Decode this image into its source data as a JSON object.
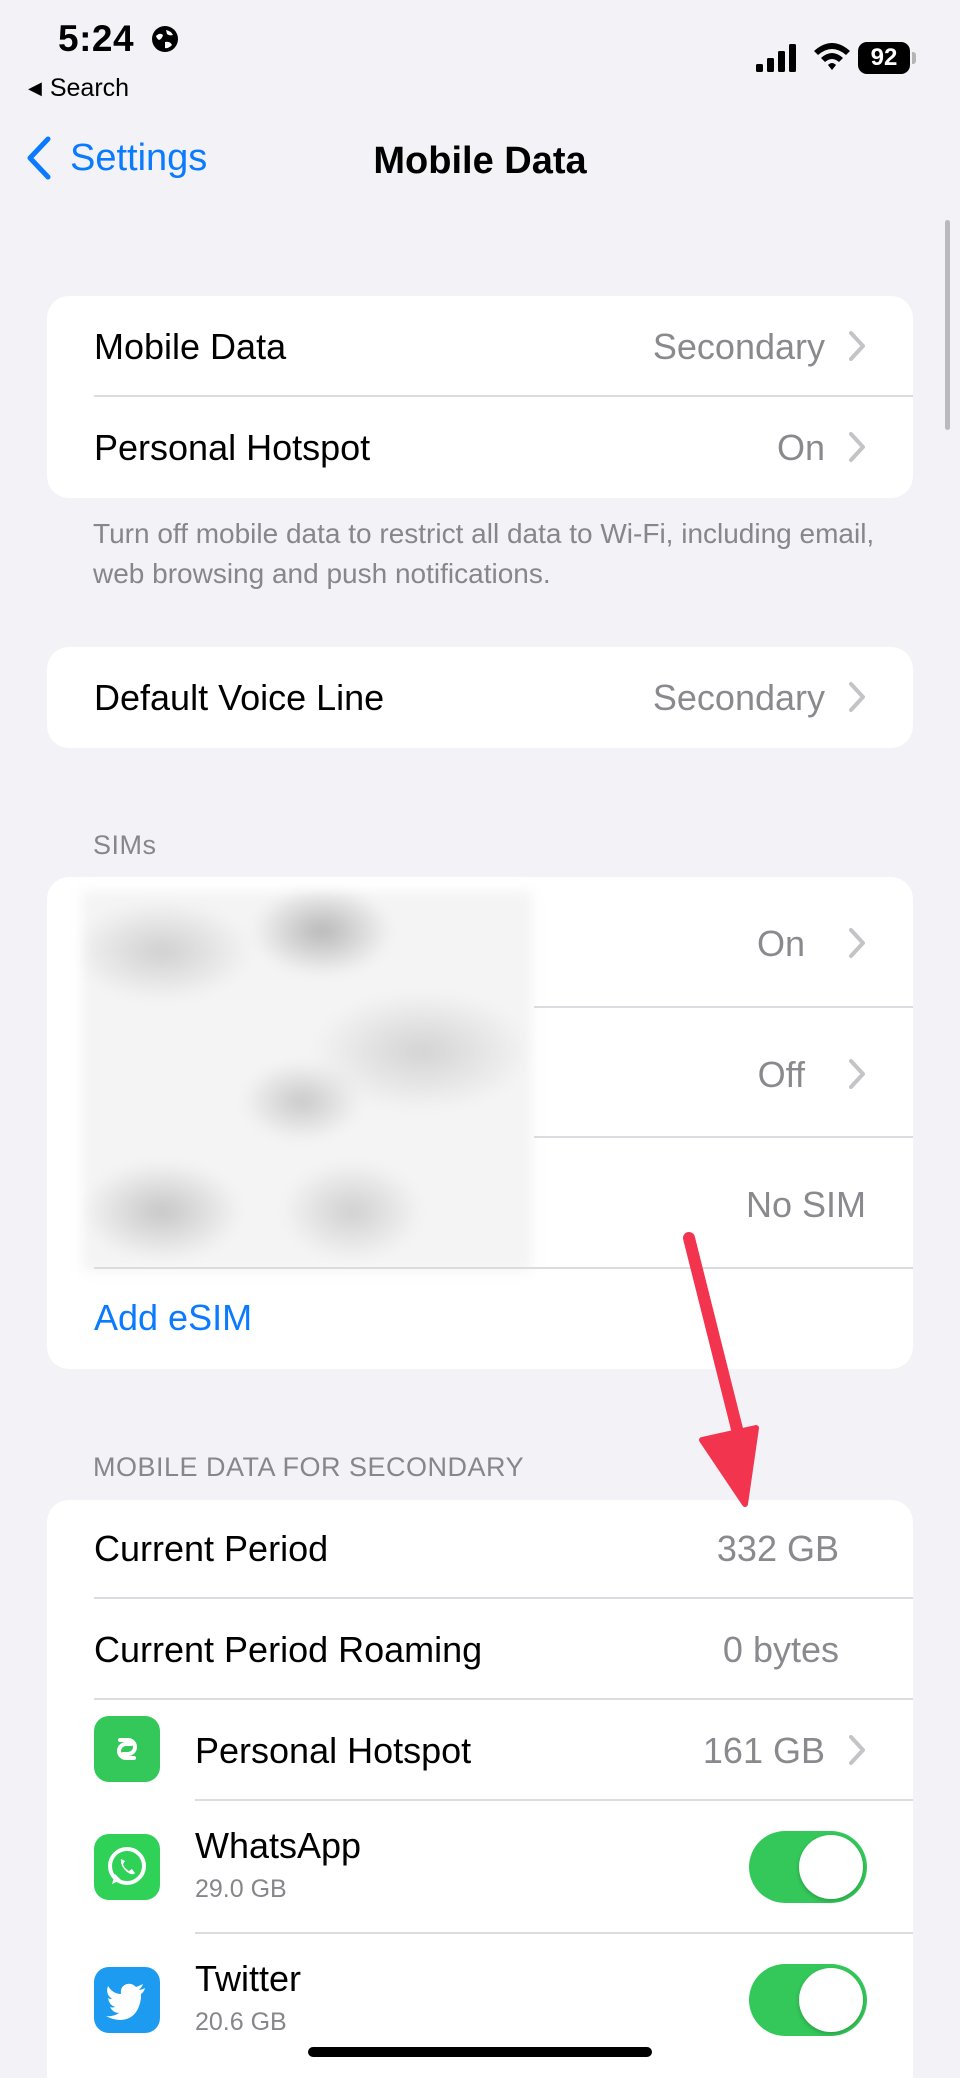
{
  "status_bar": {
    "time": "5:24",
    "back_app": "Search",
    "battery": "92"
  },
  "nav": {
    "back_label": "Settings",
    "title": "Mobile Data"
  },
  "group1": {
    "rows": [
      {
        "label": "Mobile Data",
        "value": "Secondary"
      },
      {
        "label": "Personal Hotspot",
        "value": "On"
      }
    ],
    "footer": "Turn off mobile data to restrict all data to Wi-Fi, including email, web browsing and push notifications."
  },
  "group2": {
    "rows": [
      {
        "label": "Default Voice Line",
        "value": "Secondary"
      }
    ]
  },
  "sims": {
    "header": "SIMs",
    "rows": [
      {
        "value": "On"
      },
      {
        "value": "Off"
      },
      {
        "value": "No SIM"
      }
    ],
    "add_esim": "Add eSIM"
  },
  "usage": {
    "header": "MOBILE DATA FOR SECONDARY",
    "current_period": {
      "label": "Current Period",
      "value": "332 GB"
    },
    "roaming": {
      "label": "Current Period Roaming",
      "value": "0 bytes"
    },
    "hotspot": {
      "label": "Personal Hotspot",
      "value": "161 GB"
    },
    "apps": [
      {
        "name": "WhatsApp",
        "usage": "29.0 GB",
        "enabled": true
      },
      {
        "name": "Twitter",
        "usage": "20.6 GB",
        "enabled": true
      }
    ]
  },
  "colors": {
    "accent": "#0a7aff",
    "toggle_on": "#34c759",
    "annotation_arrow": "#f2344f"
  }
}
